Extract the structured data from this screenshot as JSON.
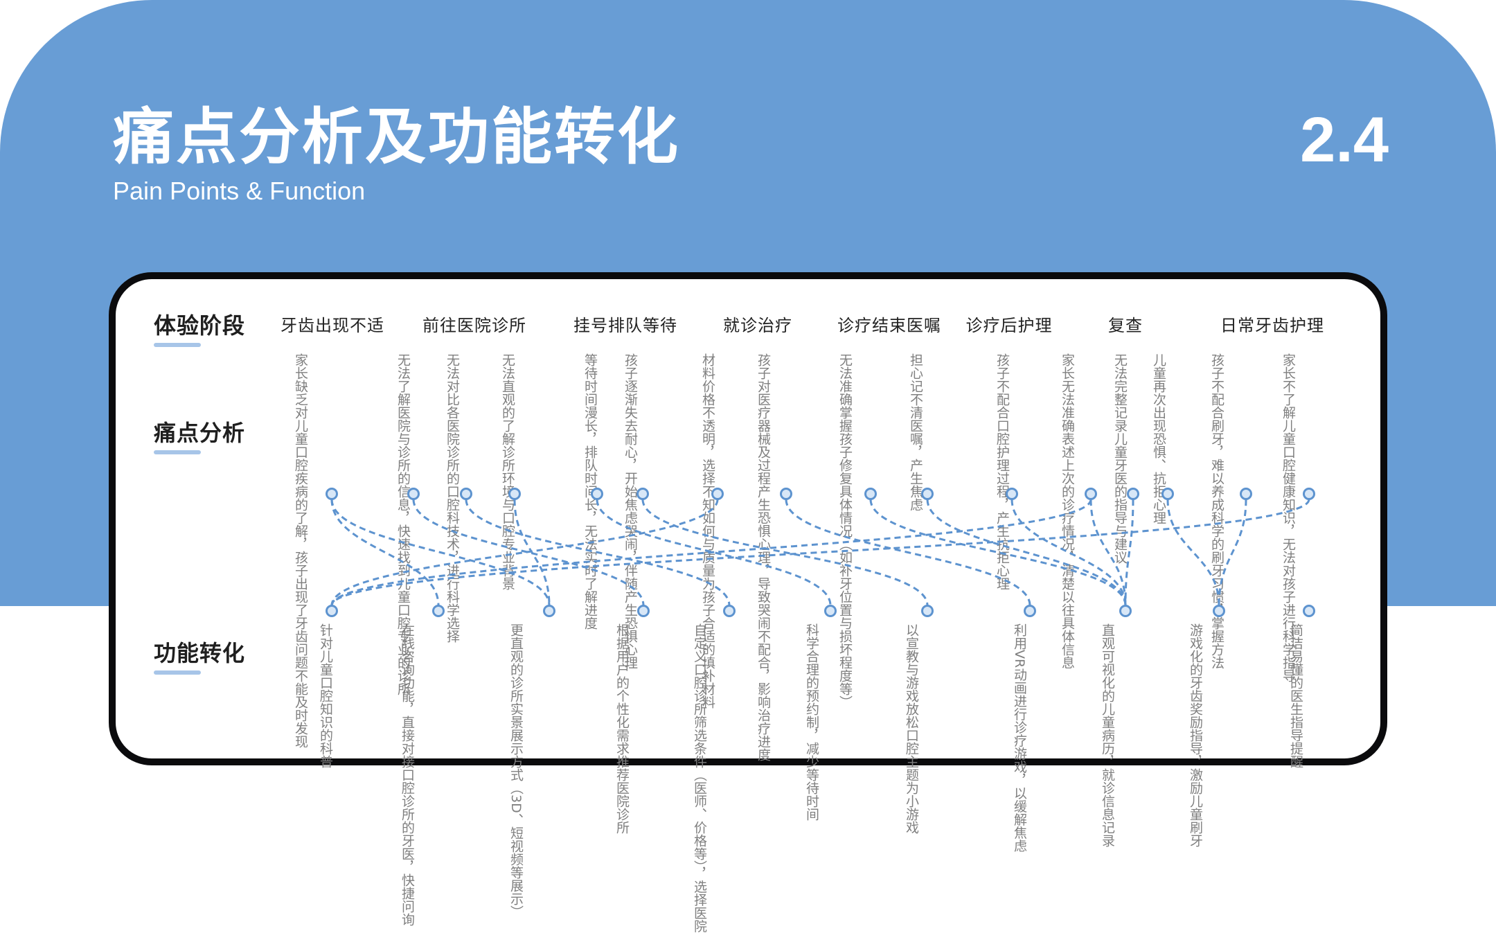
{
  "header": {
    "title": "痛点分析及功能转化",
    "subtitle": "Pain Points & Function",
    "page_number": "2.4"
  },
  "row_labels": {
    "stages": "体验阶段",
    "pain": "痛点分析",
    "function": "功能转化"
  },
  "stages": [
    "牙齿出现不适",
    "前往医院诊所",
    "挂号排队等待",
    "就诊治疗",
    "诊疗结束医嘱",
    "诊疗后护理",
    "复查",
    "日常牙齿护理"
  ],
  "pain_points": [
    "家长缺乏对儿童口腔疾病的了解，孩子出现了牙齿问题不能及时发现",
    "无法了解医院与诊所的信息，快速找到儿童口腔专业的诊所",
    "无法对比各医院诊所的口腔科技术，进行科学选择",
    "无法直观的了解诊所环境与口腔专业背景",
    "等待时间漫长，排队时间长，无法实时了解进度",
    "孩子逐渐失去耐心，开始焦虑哭闹，伴随产生恐惧心理",
    "材料价格不透明，选择不知如何与质量为孩子合适的填补材料",
    "孩子对医疗器械及过程产生恐惧心理，导致哭闹不配合，影响治疗进度",
    "无法准确掌握孩子修复具体情况（如补牙位置与损坏程度等）",
    "担心记不清医嘱，产生焦虑",
    "孩子不配合口腔护理过程，产生抗拒心理",
    "家长无法准确表述上次的诊疗情况，清楚以往具体信息",
    "无法完整记录儿童牙医的指导与建议",
    "儿童再次出现恐惧、抗拒心理",
    "孩子不配合刷牙，难以养成科学的刷牙习惯，掌握方法",
    "家长不了解儿童口腔健康知识，无法对孩子进行科学指导"
  ],
  "functions": [
    "针对儿童口腔知识的科普",
    "在线咨询功能，直接对接口腔诊所的牙医，快捷问询",
    "更直观的诊所实景展示方式（3D、短视频等展示）",
    "根据用户的个性化需求推荐医院诊所",
    "自定义口腔诊所筛选条件（医师、价格等），选择医院",
    "科学合理的预约制，减少等待时间",
    "以宣教与游戏放松口腔主题为小游戏",
    "利用VR动画进行诊疗游戏，以缓解焦虑",
    "直观可视化的儿童病历，就诊信息记录",
    "游戏化的牙齿奖励指导，激励儿童刷牙",
    "简洁易懂的医生指导提醒"
  ]
}
